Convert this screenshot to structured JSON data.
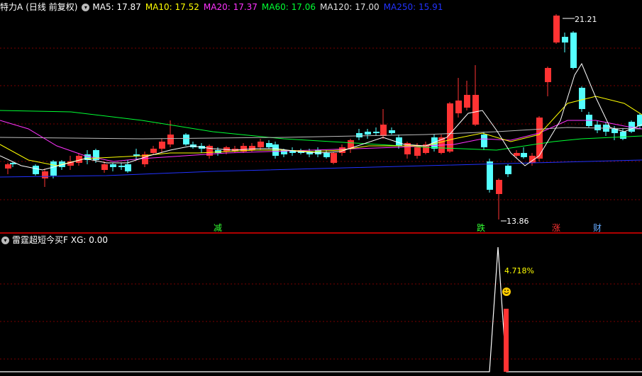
{
  "main_panel": {
    "title": "特力A",
    "mode": "(日线 前复权)",
    "ma_labels": [
      {
        "text": "MA5: 17.87",
        "color": "#ffffff"
      },
      {
        "text": "MA10: 17.52",
        "color": "#ffff00"
      },
      {
        "text": "MA20: 17.37",
        "color": "#ff33ff"
      },
      {
        "text": "MA60: 17.06",
        "color": "#00ff33"
      },
      {
        "text": "MA120: 17.00",
        "color": "#e0e0e0"
      },
      {
        "text": "MA250: 15.91",
        "color": "#2233ff"
      }
    ],
    "high_label": "21.21",
    "low_label": "13.86",
    "markers": [
      {
        "text": "减",
        "color": "#33ff33"
      },
      {
        "text": "跌",
        "color": "#33ff33"
      },
      {
        "text": "涨",
        "color": "#ff3333"
      },
      {
        "text": "财",
        "color": "#66aaff"
      }
    ]
  },
  "sub_panel": {
    "title": "雷霆超短今买F",
    "xg_label": "XG: 0.00",
    "percent_label": "4.718%",
    "smiley_icon": "smiley-face-icon"
  },
  "colors": {
    "up": "#ff3333",
    "down": "#54ffff",
    "grid": "#7a0000",
    "divider": "#b00000"
  }
}
